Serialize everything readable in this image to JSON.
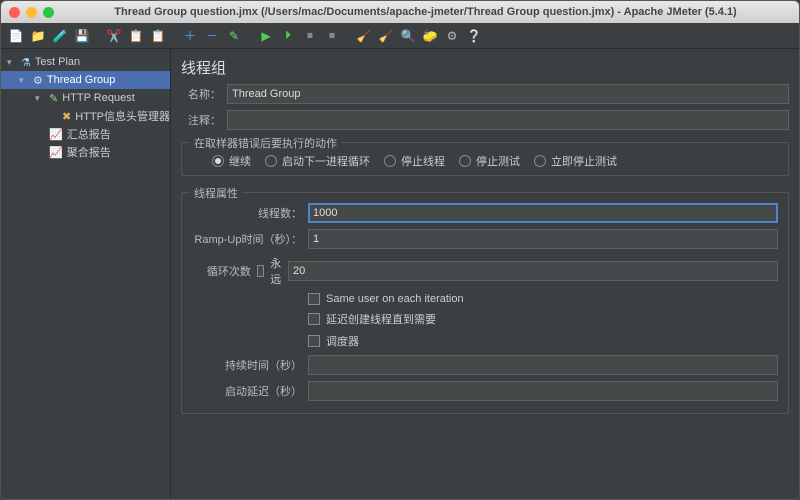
{
  "title": "Thread Group question.jmx (/Users/mac/Documents/apache-jmeter/Thread Group question.jmx) - Apache JMeter (5.4.1)",
  "tree": {
    "root": "Test Plan",
    "tg": "Thread Group",
    "http": "HTTP Request",
    "hdr": "HTTP信息头管理器",
    "sum": "汇总报告",
    "agg": "聚合报告"
  },
  "panel": {
    "heading": "线程组",
    "nameLabel": "名称：",
    "nameValue": "Thread Group",
    "commentLabel": "注释：",
    "commentValue": "",
    "errLegend": "在取样器错误后要执行的动作",
    "radios": {
      "cont": "继续",
      "next": "启动下一进程循环",
      "stopThread": "停止线程",
      "stopTest": "停止测试",
      "stopNow": "立即停止测试"
    },
    "propLegend": "线程属性",
    "threadsLabel": "线程数：",
    "threadsValue": "1000",
    "rampLabel": "Ramp-Up时间（秒）：",
    "rampValue": "1",
    "loopLabel": "循环次数",
    "foreverLabel": "永远",
    "loopValue": "20",
    "sameUser": "Same user on each iteration",
    "delayCreate": "延迟创建线程直到需要",
    "scheduler": "调度器",
    "durationLabel": "持续时间（秒）",
    "delayLabel": "启动延迟（秒）"
  }
}
